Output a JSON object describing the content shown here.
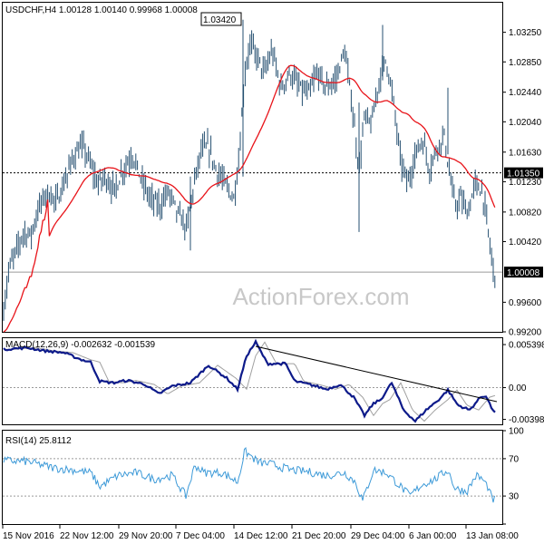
{
  "chart_data": [
    {
      "type": "ohlc",
      "title": "USDCHF,H4 1.00128 1.00140 0.99968 1.00008",
      "watermark": "ActionForex.com",
      "ylim": [
        0.992,
        1.0365
      ],
      "yticks": [
        "1.03250",
        "1.02850",
        "1.02440",
        "1.02040",
        "1.01630",
        "1.01230",
        "1.00820",
        "1.00420",
        "0.99600",
        "0.99200"
      ],
      "horizontal_line": {
        "value": 1.0135,
        "label": "1.01350"
      },
      "current_price": {
        "value": 1.00008,
        "label": "1.00008"
      },
      "high_annotation": {
        "value": 1.0342,
        "label": "1.03420"
      },
      "series": [
        {
          "name": "Moving average",
          "color": "#e8141a"
        }
      ],
      "bar_color": "#244f70"
    },
    {
      "type": "line",
      "title": "MACD(12,26,9) -0.002632 -0.001539",
      "ylim": [
        -0.0046,
        0.0062
      ],
      "yticks": [
        "0.005398",
        "0.00",
        "-0.003981"
      ],
      "colors": {
        "macd": "#0d1a8a",
        "signal": "#a0a0a0",
        "trendline": "#000000"
      }
    },
    {
      "type": "line",
      "title": "RSI(14) 25.8112",
      "ylim": [
        0,
        100
      ],
      "yticks": [
        "100",
        "70",
        "30",
        "0"
      ],
      "series": [
        {
          "name": "RSI(14)",
          "color": "#3d9ad8"
        }
      ]
    }
  ],
  "x_axis": {
    "labels": [
      "15 Nov 2016",
      "22 Nov 12:00",
      "29 Nov 20:00",
      "7 Dec 04:00",
      "14 Dec 12:00",
      "21 Dec 20:00",
      "29 Dec 04:00",
      "6 Jan 00:00",
      "13 Jan 08:00"
    ]
  }
}
